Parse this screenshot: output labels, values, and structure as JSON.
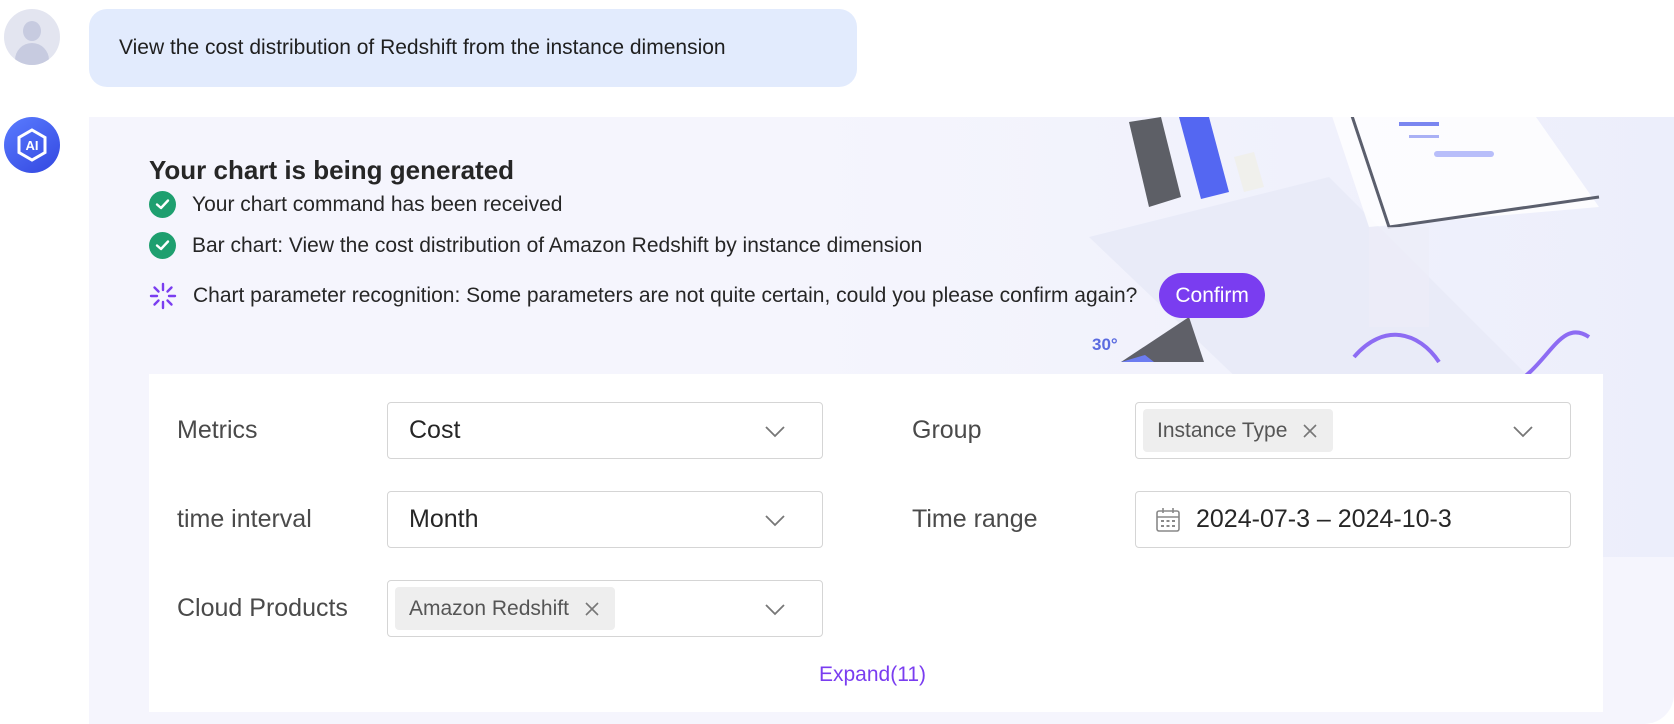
{
  "user_message": {
    "text": "View the cost distribution of Redshift from the instance dimension"
  },
  "ai_message": {
    "avatar_label": "AI",
    "title": "Your chart is being generated",
    "steps": [
      {
        "status": "done",
        "text": "Your chart command has been received"
      },
      {
        "status": "done",
        "text": "Bar chart: View the cost distribution of Amazon Redshift by instance dimension"
      },
      {
        "status": "loading",
        "text": "Chart parameter recognition: Some parameters are not quite certain, could you please confirm again?"
      }
    ],
    "confirm_label": "Confirm",
    "decoration_label": "30°"
  },
  "form": {
    "metrics": {
      "label": "Metrics",
      "value": "Cost"
    },
    "group": {
      "label": "Group",
      "tag": "Instance Type"
    },
    "time_interval": {
      "label": "time interval",
      "value": "Month"
    },
    "time_range": {
      "label": "Time range",
      "value": "2024-07-3 – 2024-10-3"
    },
    "cloud_products": {
      "label": "Cloud Products",
      "tag": "Amazon Redshift"
    },
    "expand_label": "Expand(11)"
  },
  "colors": {
    "accent_purple": "#7a3df0",
    "success_green": "#1e9f6f",
    "user_bubble": "#e2ebfd",
    "ai_panel": "#f5f5fd"
  },
  "icons": [
    "user-avatar",
    "ai-logo-icon",
    "check-circle-icon",
    "loading-spinner-icon",
    "chevron-down-icon",
    "close-icon",
    "calendar-icon"
  ]
}
